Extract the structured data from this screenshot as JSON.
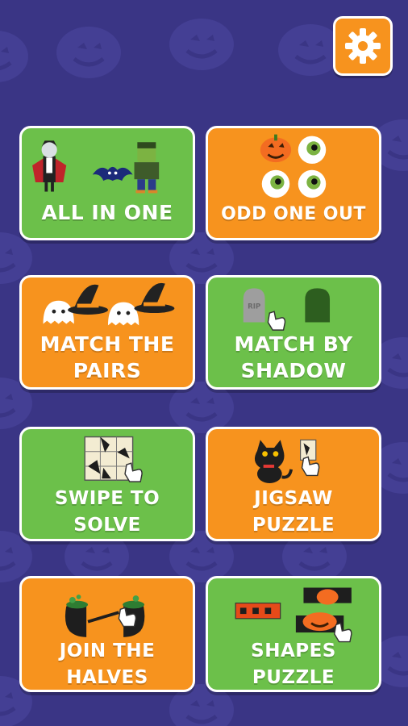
{
  "settings": {
    "icon": "gear-icon"
  },
  "menu": [
    {
      "id": "all-in-one",
      "color": "green",
      "lines": [
        "ALL IN ONE"
      ]
    },
    {
      "id": "odd-one-out",
      "color": "orange",
      "lines": [
        "ODD ONE OUT"
      ]
    },
    {
      "id": "match-the-pairs",
      "color": "orange",
      "lines": [
        "MATCH THE",
        "PAIRS"
      ]
    },
    {
      "id": "match-by-shadow",
      "color": "green",
      "lines": [
        "MATCH BY",
        "SHADOW"
      ]
    },
    {
      "id": "swipe-to-solve",
      "color": "green",
      "lines": [
        "SWIPE TO",
        "SOLVE"
      ]
    },
    {
      "id": "jigsaw-puzzle",
      "color": "orange",
      "lines": [
        "JIGSAW",
        "PUZZLE"
      ]
    },
    {
      "id": "join-the-halves",
      "color": "orange",
      "lines": [
        "JOIN THE",
        "HALVES"
      ]
    },
    {
      "id": "shapes-puzzle",
      "color": "green",
      "lines": [
        "SHAPES",
        "PUZZLE"
      ]
    }
  ],
  "gravestone_text": "RIP",
  "colors": {
    "background": "#3a3585",
    "green": "#6cc04a",
    "orange": "#f7931e"
  }
}
